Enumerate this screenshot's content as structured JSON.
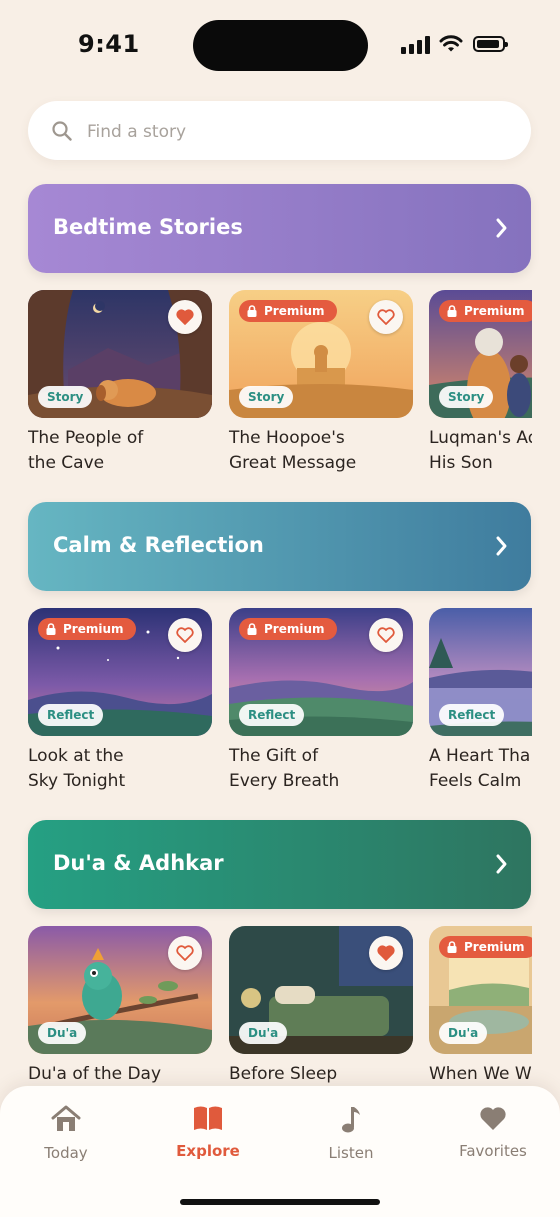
{
  "status_bar": {
    "time": "9:41"
  },
  "search": {
    "placeholder": "Find a story"
  },
  "sections": [
    {
      "title": "Bedtime Stories",
      "items": [
        {
          "title_line1": "The People of",
          "title_line2": "the Cave",
          "tag": "Story",
          "premium": false,
          "favorited": true
        },
        {
          "title_line1": "The Hoopoe's",
          "title_line2": "Great Message",
          "tag": "Story",
          "premium": true,
          "favorited": false
        },
        {
          "title_line1": "Luqman's Ad",
          "title_line2": "His Son",
          "tag": "Story",
          "premium": true,
          "favorited": false
        }
      ]
    },
    {
      "title": "Calm & Reflection",
      "items": [
        {
          "title_line1": "Look at the",
          "title_line2": "Sky Tonight",
          "tag": "Reflect",
          "premium": true,
          "favorited": false
        },
        {
          "title_line1": "The Gift of",
          "title_line2": "Every Breath",
          "tag": "Reflect",
          "premium": true,
          "favorited": false
        },
        {
          "title_line1": "A Heart Tha",
          "title_line2": "Feels Calm",
          "tag": "Reflect",
          "premium": false,
          "favorited": false
        }
      ]
    },
    {
      "title": "Du'a & Adhkar",
      "items": [
        {
          "title_line1": "Du'a of the Day",
          "title_line2": "",
          "tag": "Du'a",
          "premium": false,
          "favorited": false
        },
        {
          "title_line1": "Before Sleep",
          "title_line2": "",
          "tag": "Du'a",
          "premium": false,
          "favorited": true
        },
        {
          "title_line1": "When We W",
          "title_line2": "",
          "tag": "Du'a",
          "premium": true,
          "favorited": false
        }
      ]
    }
  ],
  "premium_label": "Premium",
  "tabs": [
    {
      "label": "Today",
      "icon": "home-icon",
      "active": false
    },
    {
      "label": "Explore",
      "icon": "book-icon",
      "active": true
    },
    {
      "label": "Listen",
      "icon": "music-note-icon",
      "active": false
    },
    {
      "label": "Favorites",
      "icon": "heart-icon",
      "active": false
    }
  ],
  "colors": {
    "accent": "#e05a3c",
    "background": "#f8efe6",
    "premium": "#e45b3f",
    "tag_text": "#2c8f83"
  }
}
